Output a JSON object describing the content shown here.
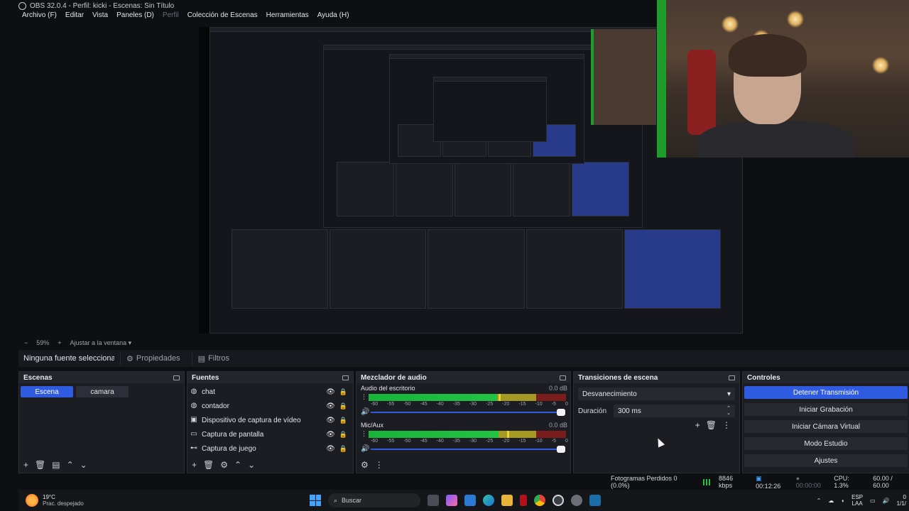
{
  "window": {
    "title": "OBS 32.0.4 - Perfil: kicki - Escenas: Sin Título"
  },
  "menu": [
    {
      "label": "Archivo (F)",
      "dim": false
    },
    {
      "label": "Editar",
      "dim": false
    },
    {
      "label": "Vista",
      "dim": false
    },
    {
      "label": "Paneles (D)",
      "dim": false
    },
    {
      "label": "Perfil",
      "dim": true
    },
    {
      "label": "Colección de Escenas",
      "dim": false
    },
    {
      "label": "Herramientas",
      "dim": false
    },
    {
      "label": "Ayuda (H)",
      "dim": false
    }
  ],
  "zoom": {
    "minus": "−",
    "value": "59%",
    "plus": "+",
    "fit": "Ajustar a la ventana"
  },
  "source_bar": {
    "no_selection": "Ninguna fuente seleccionada",
    "properties": "Propiedades",
    "filters": "Filtros"
  },
  "scenes": {
    "title": "Escenas",
    "items": [
      {
        "label": "Escena",
        "active": true
      },
      {
        "label": "camara",
        "active": false
      }
    ]
  },
  "sources": {
    "title": "Fuentes",
    "items": [
      {
        "label": "chat",
        "icon": "globe-icon"
      },
      {
        "label": "contador",
        "icon": "globe-icon"
      },
      {
        "label": "Dispositivo de captura de vídeo",
        "icon": "camera-icon"
      },
      {
        "label": "Captura de pantalla",
        "icon": "monitor-icon"
      },
      {
        "label": "Captura de juego",
        "icon": "gamepad-icon"
      }
    ]
  },
  "mixer": {
    "title": "Mezclador de audio",
    "scale": [
      "-60",
      "-55",
      "-50",
      "-45",
      "-40",
      "-35",
      "-30",
      "-25",
      "-20",
      "-15",
      "-10",
      "-5",
      "0"
    ],
    "channels": [
      {
        "name": "Audio del escritorio",
        "db": "0.0 dB",
        "level": 0.65
      },
      {
        "name": "Mic/Aux",
        "db": "0.0 dB",
        "level": 0.71
      }
    ]
  },
  "transitions": {
    "title": "Transiciones de escena",
    "selected": "Desvanecimiento",
    "duration_label": "Duración",
    "duration_value": "300 ms"
  },
  "controls": {
    "title": "Controles",
    "buttons": [
      {
        "label": "Detener Transmisión",
        "primary": true
      },
      {
        "label": "Iniciar Grabación",
        "primary": false
      },
      {
        "label": "Iniciar Cámara Virtual",
        "primary": false
      },
      {
        "label": "Modo Estudio",
        "primary": false
      },
      {
        "label": "Ajustes",
        "primary": false
      }
    ]
  },
  "status": {
    "dropped": "Fotogramas Perdidos 0 (0.0%)",
    "bitrate": "8846 kbps",
    "stream_time": "00:12:26",
    "rec_time": "00:00:00",
    "cpu": "CPU: 1.3%",
    "fps": "60.00 / 60.00"
  },
  "taskbar": {
    "weather_temp": "19°C",
    "weather_desc": "Prac. despejado",
    "search": "Buscar",
    "lang1": "ESP",
    "lang2": "LAA",
    "time": "0",
    "date": "1/1/"
  },
  "colors": {
    "accent": "#2f5be0",
    "meter_green": "#22c243",
    "meter_yellow": "#a49a23",
    "meter_red": "#7c1d1d",
    "webcam_border": "#1d9e2a"
  }
}
